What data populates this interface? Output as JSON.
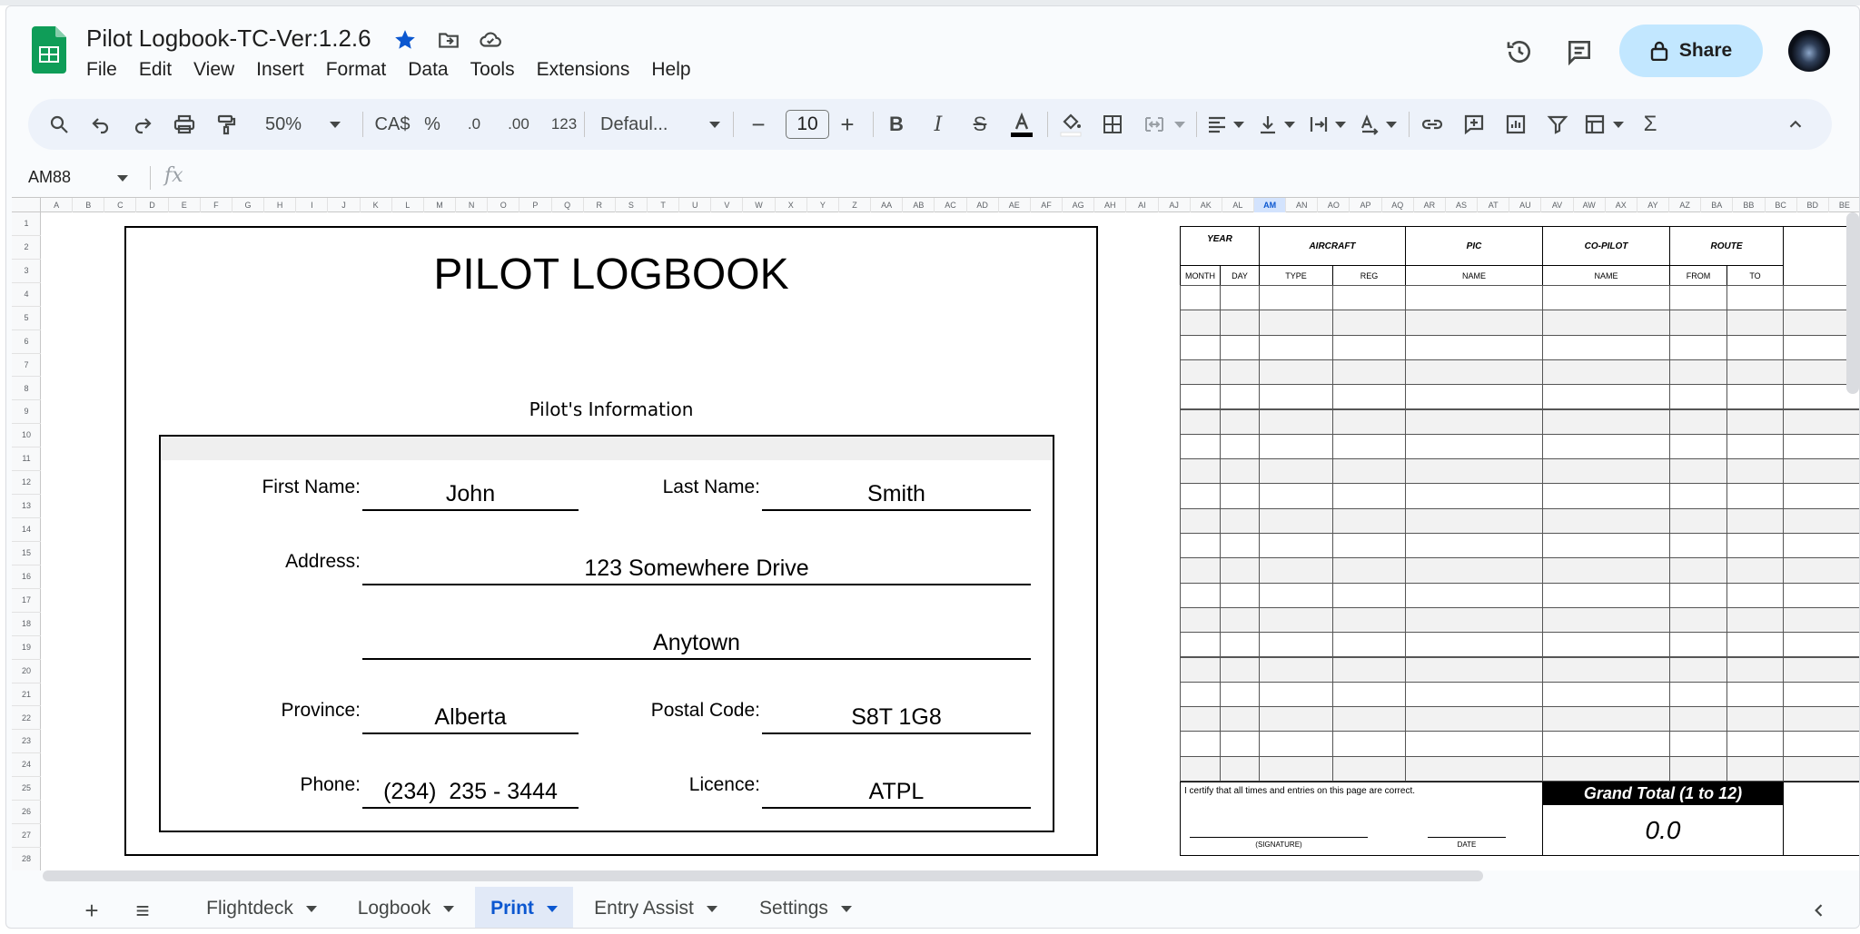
{
  "app": {
    "doc_title": "Pilot Logbook-TC-Ver:1.2.6",
    "menu": [
      "File",
      "Edit",
      "View",
      "Insert",
      "Format",
      "Data",
      "Tools",
      "Extensions",
      "Help"
    ],
    "share_label": "Share",
    "accent": "#c2e7ff"
  },
  "toolbar": {
    "zoom": "50%",
    "currency": "CA$",
    "percent": "%",
    "decrease_decimal": ".0",
    "increase_decimal": ".00",
    "number_format": "123",
    "font": "Defaul...",
    "font_size": "10",
    "minus": "−",
    "plus": "+"
  },
  "formula_bar": {
    "cell_ref": "AM88",
    "fx": "fx"
  },
  "grid": {
    "columns": [
      "A",
      "B",
      "C",
      "D",
      "E",
      "F",
      "G",
      "H",
      "I",
      "J",
      "K",
      "L",
      "M",
      "N",
      "O",
      "P",
      "Q",
      "R",
      "S",
      "T",
      "U",
      "V",
      "W",
      "X",
      "Y",
      "Z",
      "AA",
      "AB",
      "AC",
      "AD",
      "AE",
      "AF",
      "AG",
      "AH",
      "AI",
      "AJ",
      "AK",
      "AL",
      "AM",
      "AN",
      "AO",
      "AP",
      "AQ",
      "AR",
      "AS",
      "AT",
      "AU",
      "AV",
      "AW",
      "AX",
      "AY",
      "AZ",
      "BA",
      "BB",
      "BC",
      "BD",
      "BE"
    ],
    "selected_column": "AM",
    "rows": [
      "1",
      "2",
      "3",
      "4",
      "5",
      "6",
      "7",
      "8",
      "9",
      "10",
      "11",
      "12",
      "13",
      "14",
      "15",
      "16",
      "17",
      "18",
      "19",
      "20",
      "21",
      "22",
      "23",
      "24",
      "25",
      "26",
      "27",
      "28"
    ]
  },
  "logbook_cover": {
    "title": "PILOT LOGBOOK",
    "section": "Pilot's Information",
    "first_name_label": "First Name:",
    "first_name": "John",
    "last_name_label": "Last Name:",
    "last_name": "Smith",
    "address_label": "Address:",
    "address_line1": "123 Somewhere Drive",
    "address_line2": "Anytown",
    "province_label": "Province:",
    "province": "Alberta",
    "postal_label": "Postal Code:",
    "postal": "S8T 1G8",
    "phone_label": "Phone:",
    "phone": "(234)  235 - 3444",
    "licence_label": "Licence:",
    "licence": "ATPL"
  },
  "logbook_table": {
    "headers": {
      "year": "YEAR",
      "aircraft": "AIRCRAFT",
      "pic": "PIC",
      "copilot": "CO-PILOT",
      "route": "ROUTE"
    },
    "subheaders": {
      "month": "MONTH",
      "day": "DAY",
      "type": "TYPE",
      "reg": "REG",
      "pic_name": "NAME",
      "copilot_name": "NAME",
      "from": "FROM",
      "to": "TO"
    },
    "certify_text": "I certify that all times and entries on this page are correct.",
    "signature_label": "(SIGNATURE)",
    "date_label": "DATE",
    "grand_total_label": "Grand Total (1 to 12)",
    "grand_total_value": "0.0"
  },
  "sheets": {
    "add": "+",
    "list": "≡",
    "tabs": [
      "Flightdeck",
      "Logbook",
      "Print",
      "Entry Assist",
      "Settings"
    ],
    "active": "Print",
    "tab_underline_color": "#34d13a"
  }
}
